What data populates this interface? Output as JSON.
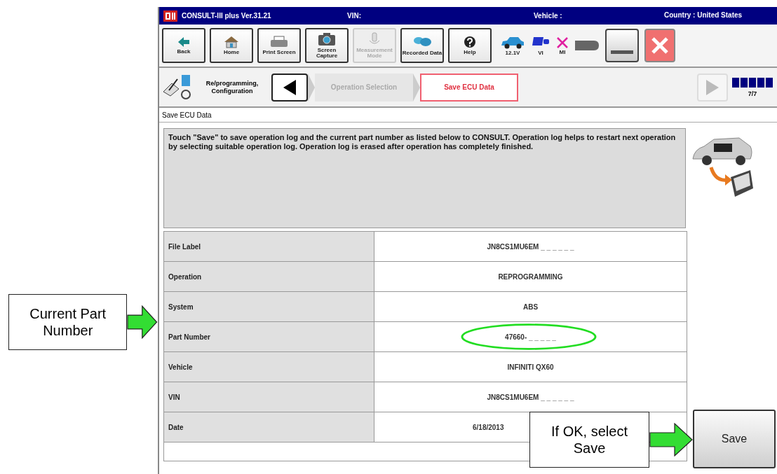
{
  "window": {
    "title": "CONSULT-III plus  Ver.31.21",
    "vin_label": "VIN:",
    "vehicle_label": "Vehicle :",
    "country": "Country : United States"
  },
  "toolbar": [
    {
      "label": "Back",
      "kind": "back",
      "disabled": false
    },
    {
      "label": "Home",
      "kind": "home",
      "disabled": false
    },
    {
      "label": "Print Screen",
      "kind": "print",
      "disabled": false
    },
    {
      "label": "Screen Capture",
      "kind": "camera",
      "disabled": false
    },
    {
      "label": "Measurement Mode",
      "kind": "measure",
      "disabled": true
    },
    {
      "label": "Recorded Data",
      "kind": "recorded",
      "disabled": false
    },
    {
      "label": "Help",
      "kind": "help",
      "disabled": false
    }
  ],
  "status": [
    {
      "label": "12.1V",
      "kind": "car"
    },
    {
      "label": "VI",
      "kind": "vi"
    },
    {
      "label": "MI",
      "kind": "mi"
    }
  ],
  "breadcrumb": {
    "section": "Re/programming, Configuration",
    "steps": [
      {
        "label": "Operation Selection",
        "selected": false
      },
      {
        "label": "Save ECU Data",
        "selected": true
      }
    ],
    "progress": {
      "label": "7/7",
      "level": 1
    }
  },
  "page_title": "Save ECU Data",
  "message": "Touch \"Save\" to save operation log and the current part number as listed below to CONSULT. Operation log helps to restart next operation by selecting suitable operation log. Operation log is erased after operation has completely finished.",
  "rows": [
    {
      "label": "File Label",
      "value": "JN8CS1MU6EM _ _ _ _ _ _",
      "highlighted": false
    },
    {
      "label": "Operation",
      "value": "REPROGRAMMING",
      "highlighted": false
    },
    {
      "label": "System",
      "value": "ABS",
      "highlighted": false
    },
    {
      "label": "Part Number",
      "value": "47660- _ _ _ _ _",
      "highlighted": true
    },
    {
      "label": "Vehicle",
      "value": "INFINITI QX60",
      "highlighted": false
    },
    {
      "label": "VIN",
      "value": "JN8CS1MU6EM _ _ _ _ _ _",
      "highlighted": false
    },
    {
      "label": "Date",
      "value": "6/18/2013",
      "highlighted": false
    }
  ],
  "save_button": "Save",
  "annotations": [
    {
      "kind": "part",
      "text": "Current Part Number"
    },
    {
      "kind": "save",
      "text": "If OK, select Save"
    }
  ]
}
